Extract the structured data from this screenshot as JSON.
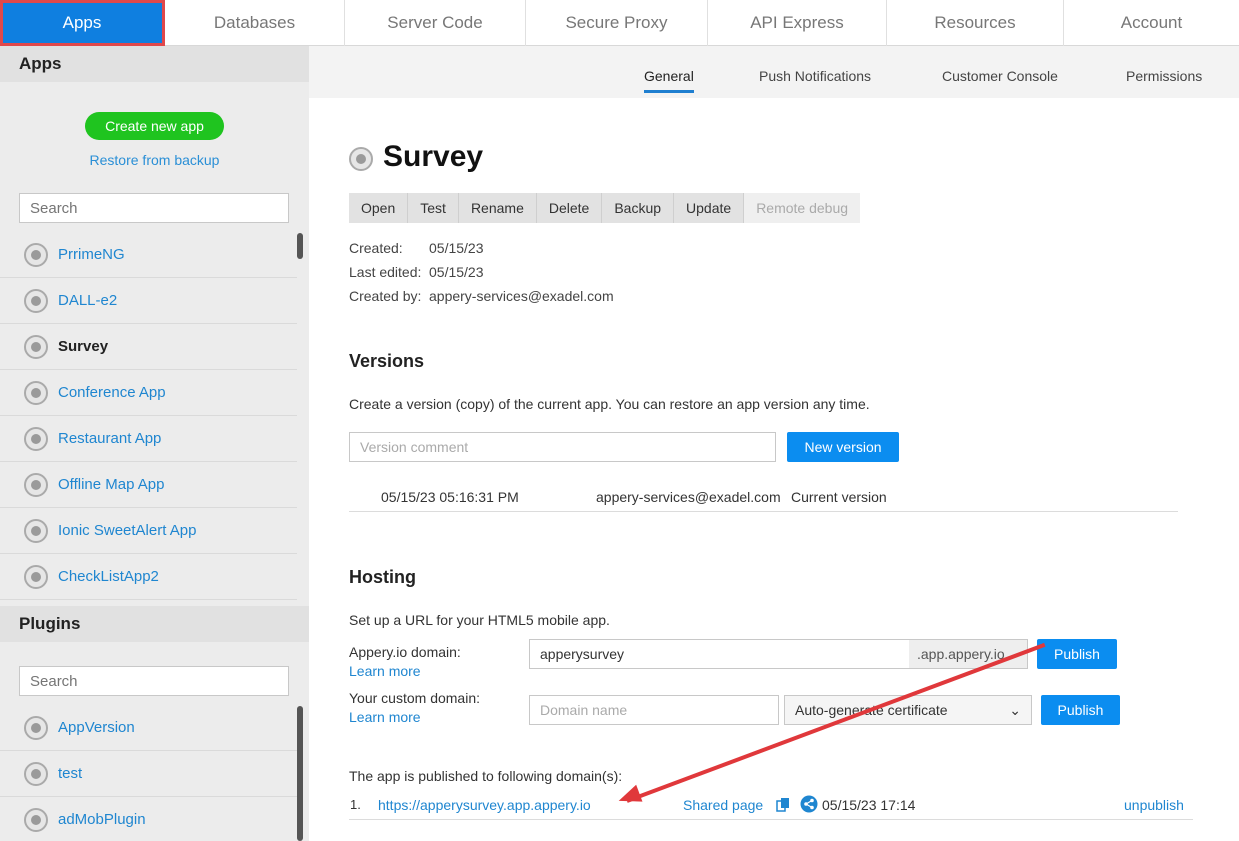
{
  "topnav": {
    "tabs": [
      {
        "label": "Apps"
      },
      {
        "label": "Databases"
      },
      {
        "label": "Server Code"
      },
      {
        "label": "Secure Proxy"
      },
      {
        "label": "API Express"
      },
      {
        "label": "Resources"
      },
      {
        "label": "Account"
      }
    ]
  },
  "sidebar": {
    "apps_title": "Apps",
    "create_label": "Create new app",
    "restore_label": "Restore from backup",
    "search_placeholder": "Search",
    "apps": [
      {
        "label": "PrrimeNG"
      },
      {
        "label": "DALL-e2"
      },
      {
        "label": "Survey"
      },
      {
        "label": "Conference App"
      },
      {
        "label": "Restaurant App"
      },
      {
        "label": "Offline Map App"
      },
      {
        "label": "Ionic SweetAlert App"
      },
      {
        "label": "CheckListApp2"
      }
    ],
    "plugins_title": "Plugins",
    "plugins_search_placeholder": "Search",
    "plugins": [
      {
        "label": "AppVersion"
      },
      {
        "label": "test"
      },
      {
        "label": "adMobPlugin"
      }
    ]
  },
  "subtabs": [
    {
      "label": "General"
    },
    {
      "label": "Push Notifications"
    },
    {
      "label": "Customer Console"
    },
    {
      "label": "Permissions"
    }
  ],
  "app": {
    "title": "Survey",
    "actions": [
      "Open",
      "Test",
      "Rename",
      "Delete",
      "Backup",
      "Update",
      "Remote debug"
    ],
    "created_label": "Created:",
    "created_value": "05/15/23",
    "edited_label": "Last edited:",
    "edited_value": "05/15/23",
    "created_by_label": "Created by:",
    "created_by_value": "appery-services@exadel.com"
  },
  "versions": {
    "title": "Versions",
    "description": "Create a version (copy) of the current app. You can restore an app version any time.",
    "comment_placeholder": "Version comment",
    "new_version_label": "New version",
    "rows": [
      {
        "date": "05/15/23 05:16:31 PM",
        "user": "appery-services@exadel.com",
        "status": "Current version"
      }
    ]
  },
  "hosting": {
    "title": "Hosting",
    "description": "Set up a URL for your HTML5 mobile app.",
    "appery_domain_label": "Appery.io domain:",
    "learn_more": "Learn more",
    "appery_domain_value": "apperysurvey",
    "appery_domain_suffix": ".app.appery.io",
    "publish_label": "Publish",
    "custom_domain_label": "Your custom domain:",
    "custom_domain_placeholder": "Domain name",
    "certificate_option": "Auto-generate certificate",
    "published_heading": "The app is published to following domain(s):",
    "published": [
      {
        "index": "1.",
        "url": "https://apperysurvey.app.appery.io",
        "shared_page": "Shared page",
        "timestamp": "05/15/23 17:14",
        "unpublish": "unpublish"
      }
    ]
  },
  "colors": {
    "accent": "#0b8df0",
    "highlight": "#e0383b",
    "create_button": "#1fc41f"
  }
}
